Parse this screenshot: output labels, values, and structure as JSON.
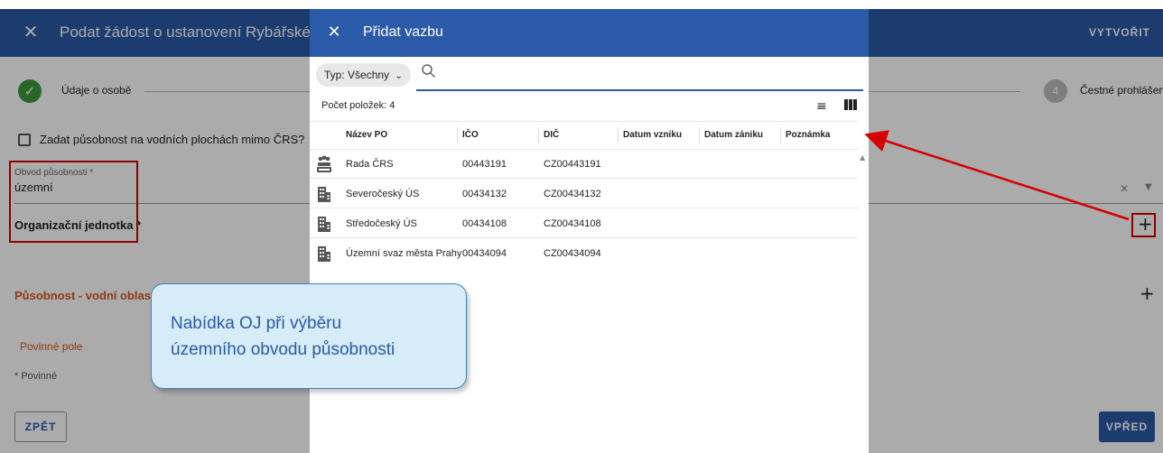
{
  "page": {
    "title": "Podat žádost o ustanovení Rybářské s",
    "create_label": "VYTVOŘIT",
    "step1_label": "Údaje o osobě",
    "step4_label": "Čestné prohlášení",
    "step4_number": "4",
    "checkbox_label": "Zadat působnost na vodních plochách mimo ČRS?",
    "field_small_label": "Obvod působnosti *",
    "field_value": "územní",
    "org_label": "Organizační jednotka *",
    "puso_label": "Působnost - vodní oblasti",
    "required_field": "Povinné pole",
    "required_note": "* Povinné",
    "back_label": "ZPĚT",
    "next_label": "VPŘED"
  },
  "dialog": {
    "title": "Přidat vazbu",
    "type_filter": "Typ: Všechny",
    "search_value": "",
    "count_label": "Počet položek: 4",
    "columns": [
      "Název PO",
      "IČO",
      "DIČ",
      "Datum vzniku",
      "Datum zániku",
      "Poznámka"
    ],
    "rows": [
      {
        "icon": "fishing-union-logo-icon",
        "name": "Rada ČRS",
        "ico": "00443191",
        "dic": "CZ00443191"
      },
      {
        "icon": "building-icon",
        "name": "Severočeský ÚS",
        "ico": "00434132",
        "dic": "CZ00434132"
      },
      {
        "icon": "building-icon",
        "name": "Středočeský ÚS",
        "ico": "00434108",
        "dic": "CZ00434108"
      },
      {
        "icon": "building-icon",
        "name": "Územní svaz města Prahy",
        "ico": "00434094",
        "dic": "CZ00434094"
      }
    ]
  },
  "callout": {
    "line1": "Nabídka OJ při výběru",
    "line2": "územního obvodu působnosti"
  },
  "colors": {
    "header_blue": "#2a5aa8",
    "annotation_red": "#d40000",
    "warning_orange": "#d8571f",
    "success_green": "#3c9a3c",
    "callout_fill": "#d6ecf8"
  }
}
